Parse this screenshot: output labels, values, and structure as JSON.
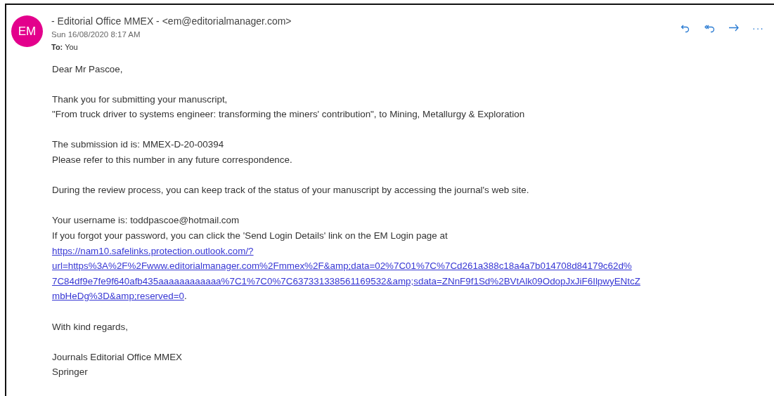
{
  "header": {
    "avatar": "EM",
    "sender": "- Editorial Office MMEX - <em@editorialmanager.com>",
    "date": "Sun 16/08/2020 8:17 AM",
    "to_label": "To:",
    "to_value": "You",
    "actions": [
      {
        "kind": "reply"
      },
      {
        "kind": "reply_all"
      },
      {
        "kind": "forward"
      },
      {
        "kind": "more",
        "text": "···"
      }
    ]
  },
  "body": [
    {
      "kind": "text",
      "lines": [
        "Dear Mr Pascoe,"
      ]
    },
    {
      "kind": "text",
      "lines": [
        "Thank you for submitting your manuscript,",
        "\"From truck driver to systems engineer: transforming the miners' contribution\", to Mining, Metallurgy & Exploration"
      ]
    },
    {
      "kind": "text",
      "lines": [
        "The submission id is: MMEX-D-20-00394",
        "Please refer to this number in any future correspondence."
      ]
    },
    {
      "kind": "text",
      "lines": [
        "During the review process, you can keep track of the status of your manuscript by accessing the journal's web site."
      ]
    },
    {
      "kind": "text_link",
      "lines": [
        "Your username is: toddpascoe@hotmail.com",
        "If you forgot your password, you can click the 'Send Login Details' link on the EM Login page at"
      ],
      "link_lines": [
        "https://nam10.safelinks.protection.outlook.com/?",
        "url=https%3A%2F%2Fwww.editorialmanager.com%2Fmmex%2F&amp;data=02%7C01%7C%7Cd261a388c18a4a7b014708d84179c62d%",
        "7C84df9e7fe9f640afb435aaaaaaaaaaaa%7C1%7C0%7C637331338561169532&amp;sdata=ZNnF9f1Sd%2BVtAlk09OdopJxJiF6IlpwyENtcZ",
        "mbHeDg%3D&amp;reserved=0"
      ],
      "after": "."
    },
    {
      "kind": "text",
      "lines": [
        "With kind regards,"
      ]
    },
    {
      "kind": "text",
      "lines": [
        "Journals Editorial Office MMEX",
        "Springer"
      ]
    }
  ]
}
